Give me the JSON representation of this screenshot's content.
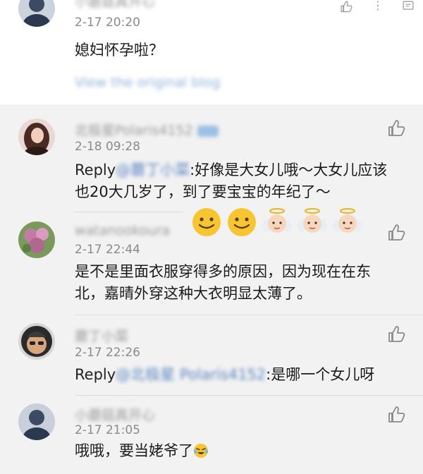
{
  "top_comment": {
    "author": "小蘑菇真开心",
    "time": "2-17 20:20",
    "text": "媳妇怀孕啦？",
    "view_original": "View the original blog"
  },
  "comments": [
    {
      "author": "北极星Polaris4152",
      "time": "2-18 09:28",
      "reply_prefix": "Reply",
      "mention": "@蘑丁小菜",
      "text": ":好像是大女儿哦～大女儿应该也20大几岁了，到了要宝宝的年纪了～"
    },
    {
      "author": "watanookoura",
      "time": "2-17 22:44",
      "text": "是不是里面衣服穿得多的原因，因为现在在东北，嘉晴外穿这种大衣明显太薄了。"
    },
    {
      "author": "蘑丁小菜",
      "time": "2-17 22:26",
      "reply_prefix": "Reply",
      "mention": "@北极星 Polaris4152",
      "text": ":是哪一个女儿呀"
    },
    {
      "author": "小蘑菇真开心",
      "time": "2-17 21:05",
      "text": "哦哦，要当姥爷了"
    }
  ],
  "icons": {
    "like": "thumbs-up-icon",
    "smile": "slightly-smiling-face-icon",
    "angel": "baby-angel-icon",
    "laugh": "laughing-tears-icon"
  },
  "colors": {
    "background": "#f2f2f2",
    "link": "#5b86c4",
    "time": "#8a8a8a"
  }
}
